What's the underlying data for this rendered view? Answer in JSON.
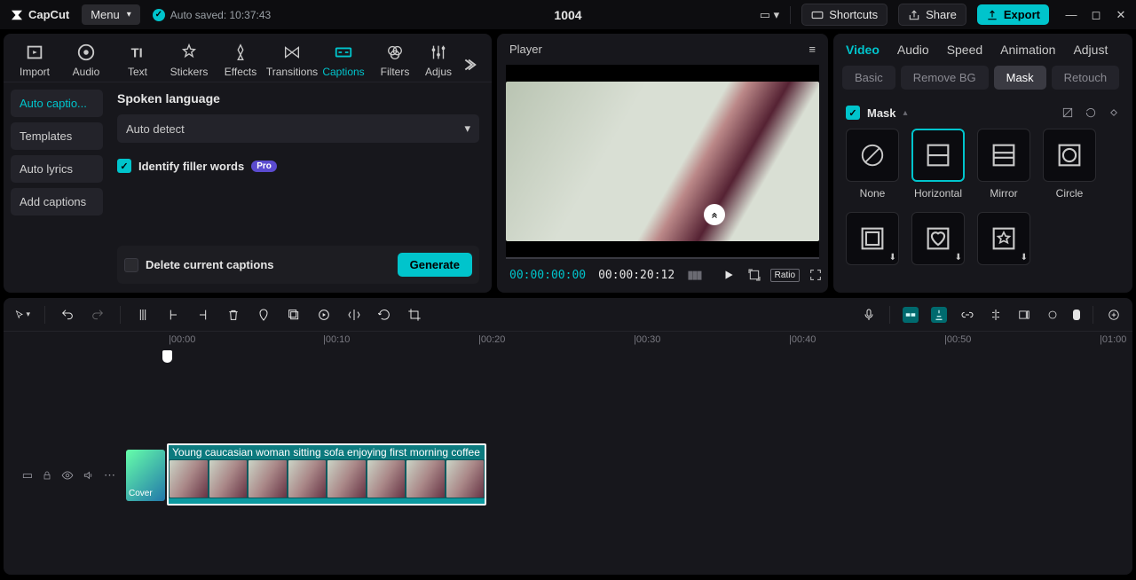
{
  "app": {
    "name": "CapCut"
  },
  "topbar": {
    "menu": "Menu",
    "autosave": "Auto saved: 10:37:43",
    "title": "1004",
    "shortcuts": "Shortcuts",
    "share": "Share",
    "export": "Export"
  },
  "tools": {
    "import": "Import",
    "audio": "Audio",
    "text": "Text",
    "stickers": "Stickers",
    "effects": "Effects",
    "transitions": "Transitions",
    "captions": "Captions",
    "filters": "Filters",
    "adjust": "Adjus"
  },
  "captions": {
    "tab_auto": "Auto captio...",
    "tab_templates": "Templates",
    "tab_autolyrics": "Auto lyrics",
    "tab_add": "Add captions",
    "lang_title": "Spoken language",
    "lang_value": "Auto detect",
    "filler_label": "Identify filler words",
    "filler_pro": "Pro",
    "delete_label": "Delete current captions",
    "generate": "Generate"
  },
  "player": {
    "title": "Player",
    "tc_current": "00:00:00:00",
    "tc_total": "00:00:20:12",
    "ratio": "Ratio"
  },
  "inspector": {
    "tab_video": "Video",
    "tab_audio": "Audio",
    "tab_speed": "Speed",
    "tab_animation": "Animation",
    "tab_adjust": "Adjust",
    "sub_basic": "Basic",
    "sub_removebg": "Remove BG",
    "sub_mask": "Mask",
    "sub_retouch": "Retouch",
    "mask_label": "Mask",
    "mask_none": "None",
    "mask_horizontal": "Horizontal",
    "mask_mirror": "Mirror",
    "mask_circle": "Circle"
  },
  "timeline": {
    "ticks": [
      "00:00",
      "00:10",
      "00:20",
      "00:30",
      "00:40",
      "00:50",
      "01:00"
    ],
    "cover": "Cover",
    "clip_title": "Young caucasian woman sitting sofa enjoying first morning coffee"
  }
}
